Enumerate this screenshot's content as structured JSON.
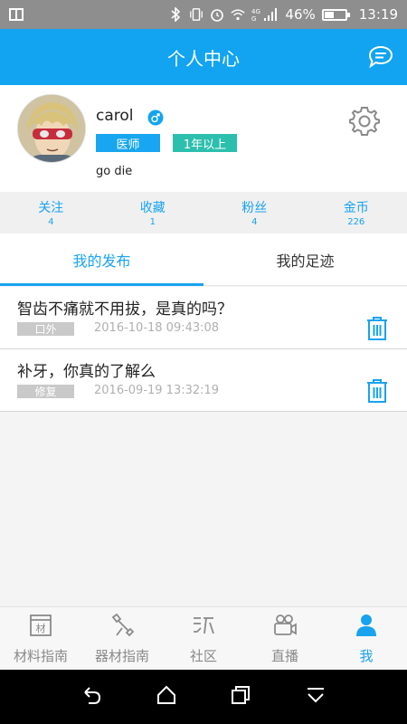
{
  "status_bar": {
    "battery_percent": "46%",
    "battery_level": 0.46,
    "time": "13:19",
    "network_label_top": "4G",
    "network_label_bottom": "G"
  },
  "header": {
    "title": "个人中心"
  },
  "profile": {
    "username": "carol",
    "role_badge": "医师",
    "experience_badge": "1年以上",
    "bio": "go die"
  },
  "stats": [
    {
      "label": "关注",
      "value": "4"
    },
    {
      "label": "收藏",
      "value": "1"
    },
    {
      "label": "粉丝",
      "value": "4"
    },
    {
      "label": "金币",
      "value": "226"
    }
  ],
  "tabs": [
    {
      "label": "我的发布",
      "active": true
    },
    {
      "label": "我的足迹",
      "active": false
    }
  ],
  "posts": [
    {
      "title": "智齿不痛就不用拔，是真的吗？",
      "tag": "口外",
      "time": "2016-10-18  09:43:08"
    },
    {
      "title": "补牙，你真的了解么",
      "tag": "修复",
      "time": "2016-09-19  13:32:19"
    }
  ],
  "bottom_nav": [
    {
      "label": "材料指南",
      "icon": "material-icon",
      "active": false
    },
    {
      "label": "器材指南",
      "icon": "equipment-icon",
      "active": false
    },
    {
      "label": "社区",
      "icon": "community-icon",
      "active": false
    },
    {
      "label": "直播",
      "icon": "camera-icon",
      "active": false
    },
    {
      "label": "我",
      "icon": "person-icon",
      "active": true
    }
  ],
  "colors": {
    "accent": "#12a4f0",
    "teal": "#2dbfae"
  }
}
